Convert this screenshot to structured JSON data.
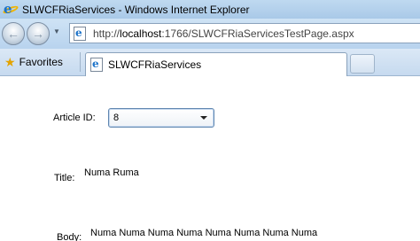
{
  "window": {
    "title": "SLWCFRiaServices - Windows Internet Explorer"
  },
  "address_bar": {
    "url_prefix": "http://",
    "url_host": "localhost",
    "url_rest": ":1766/SLWCFRiaServicesTestPage.aspx"
  },
  "toolbar": {
    "favorites_label": "Favorites",
    "tab_label": "SLWCFRiaServices"
  },
  "form": {
    "article_id_label": "Article ID:",
    "article_id_value": "8",
    "title_label": "Title:",
    "title_value": "Numa Ruma",
    "body_label": "Body:",
    "body_value": "Numa Numa Numa Numa Numa Numa Numa Numa"
  },
  "colors": {
    "title_bar": "#bfd9f0",
    "combo_border": "#5f86b0"
  },
  "icons": [
    "ie-logo-icon",
    "back-arrow-icon",
    "forward-arrow-icon",
    "page-icon",
    "favorites-star-icon",
    "dropdown-arrow-icon"
  ]
}
